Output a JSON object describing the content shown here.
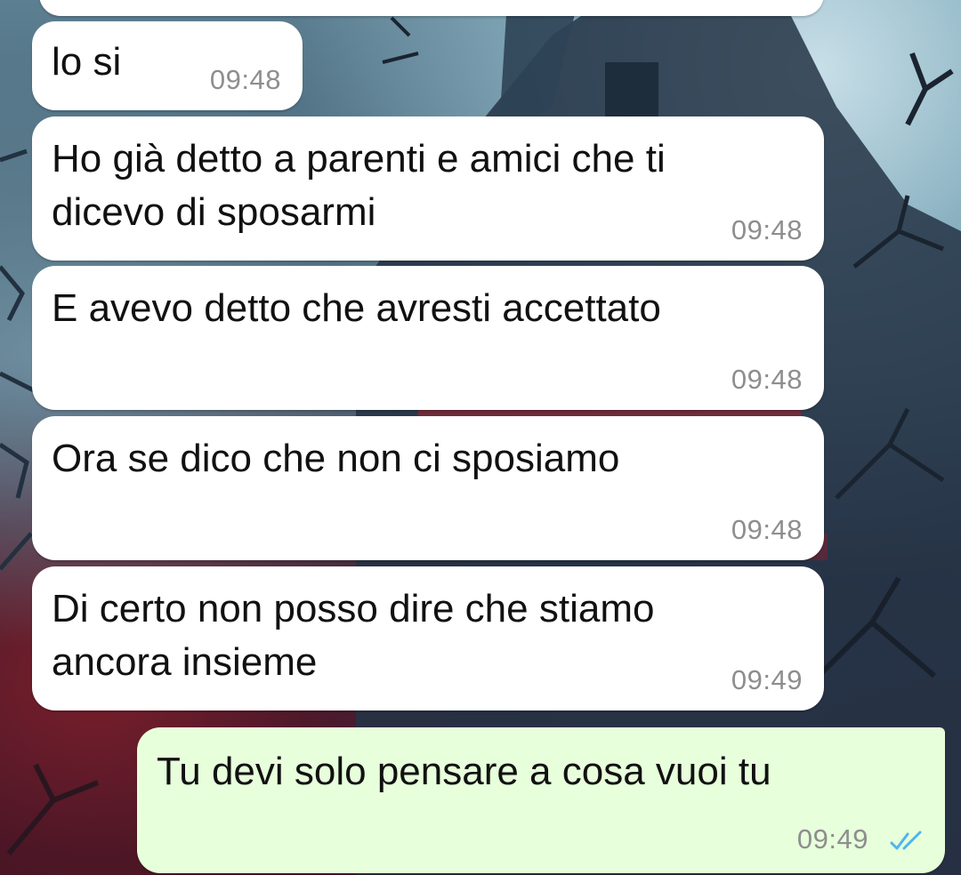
{
  "colors": {
    "incoming_bubble": "#ffffff",
    "outgoing_bubble": "#e7ffdb",
    "timestamp": "#8e8e8e",
    "read_ticks": "#4fb6ec"
  },
  "messages": [
    {
      "direction": "incoming",
      "text": "lo si",
      "time": "09:48"
    },
    {
      "direction": "incoming",
      "text": "Ho già detto a parenti e amici che ti\ndicevo di sposarmi",
      "time": "09:48"
    },
    {
      "direction": "incoming",
      "text": "E avevo detto che avresti accettato",
      "time": "09:48"
    },
    {
      "direction": "incoming",
      "text": "Ora se dico che non ci sposiamo",
      "time": "09:48"
    },
    {
      "direction": "incoming",
      "text": "Di certo non posso dire che stiamo\nancora insieme",
      "time": "09:49"
    },
    {
      "direction": "outgoing",
      "text": "Tu devi solo pensare a cosa vuoi tu",
      "time": "09:49",
      "status_icon": "double-check-read-icon"
    }
  ]
}
